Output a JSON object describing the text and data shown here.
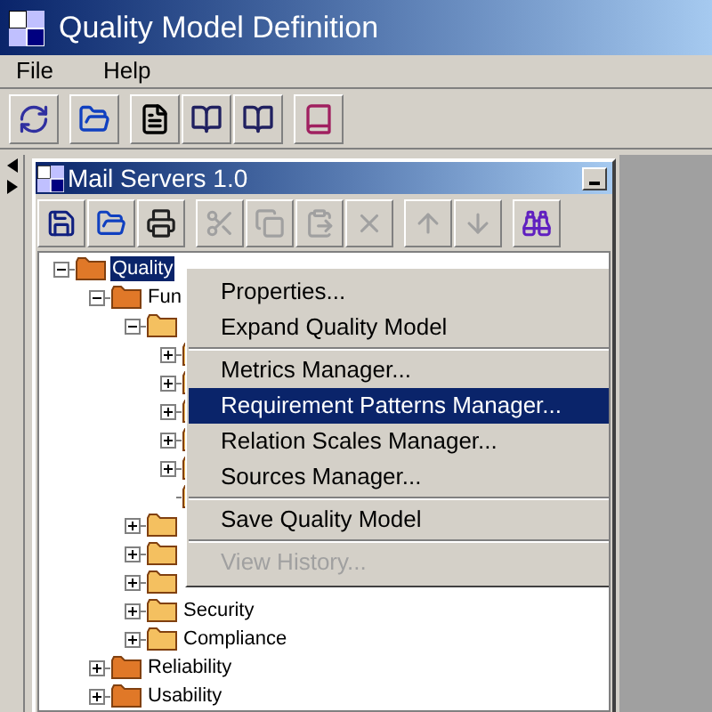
{
  "window": {
    "title": "Quality Model Definition"
  },
  "menu": [
    "File",
    "Help"
  ],
  "toolbar": [
    [
      {
        "kind": "refresh"
      }
    ],
    [
      {
        "kind": "open"
      }
    ],
    [
      {
        "kind": "document"
      },
      {
        "kind": "book"
      },
      {
        "kind": "book"
      }
    ],
    [
      {
        "kind": "help"
      }
    ]
  ],
  "inner_window": {
    "title": "Mail Servers 1.0",
    "toolbar": [
      [
        {
          "kind": "save",
          "disabled": false
        },
        {
          "kind": "open",
          "disabled": false
        },
        {
          "kind": "print",
          "disabled": false
        }
      ],
      [
        {
          "kind": "cut",
          "disabled": true
        },
        {
          "kind": "copy",
          "disabled": true
        },
        {
          "kind": "paste",
          "disabled": true
        },
        {
          "kind": "delete",
          "disabled": true
        }
      ],
      [
        {
          "kind": "up",
          "disabled": true
        },
        {
          "kind": "down",
          "disabled": true
        }
      ],
      [
        {
          "kind": "find",
          "disabled": false
        }
      ]
    ],
    "tree": [
      {
        "label": "Quality",
        "selected": true,
        "expanded": true,
        "children": [
          {
            "label": "Fun",
            "selected": false,
            "expanded": true,
            "children": [
              {
                "expanded": true,
                "children": [
                  {
                    "kind": "folder",
                    "expanded": false
                  },
                  {
                    "kind": "folder",
                    "expanded": false
                  },
                  {
                    "kind": "folder",
                    "expanded": false
                  },
                  {
                    "kind": "folder",
                    "expanded": false
                  },
                  {
                    "kind": "folder",
                    "expanded": false
                  },
                  {
                    "kind": "leaf"
                  }
                ]
              },
              {
                "expanded": false
              },
              {
                "expanded": false
              },
              {
                "expanded": false
              },
              {
                "label": "Security",
                "selected": false,
                "expanded": false
              },
              {
                "label": "Compliance",
                "selected": false,
                "expanded": false
              }
            ]
          },
          {
            "label": "Reliability",
            "selected": false,
            "expanded": false
          },
          {
            "label": "Usability",
            "selected": false,
            "expanded": false
          }
        ]
      }
    ]
  },
  "context_menu": [
    {
      "kind": "item",
      "label": "Properties...",
      "selected": false,
      "disabled": false
    },
    {
      "kind": "item",
      "label": "Expand Quality Model",
      "selected": false,
      "disabled": false
    },
    {
      "kind": "separator"
    },
    {
      "kind": "item",
      "label": "Metrics Manager...",
      "selected": false,
      "disabled": false
    },
    {
      "kind": "item",
      "label": "Requirement Patterns Manager...",
      "selected": true,
      "disabled": false
    },
    {
      "kind": "item",
      "label": "Relation Scales Manager...",
      "selected": false,
      "disabled": false
    },
    {
      "kind": "item",
      "label": "Sources Manager...",
      "selected": false,
      "disabled": false
    },
    {
      "kind": "separator"
    },
    {
      "kind": "item",
      "label": "Save Quality Model",
      "selected": false,
      "disabled": false
    },
    {
      "kind": "separator"
    },
    {
      "kind": "item",
      "label": "View History...",
      "selected": false,
      "disabled": true
    }
  ]
}
